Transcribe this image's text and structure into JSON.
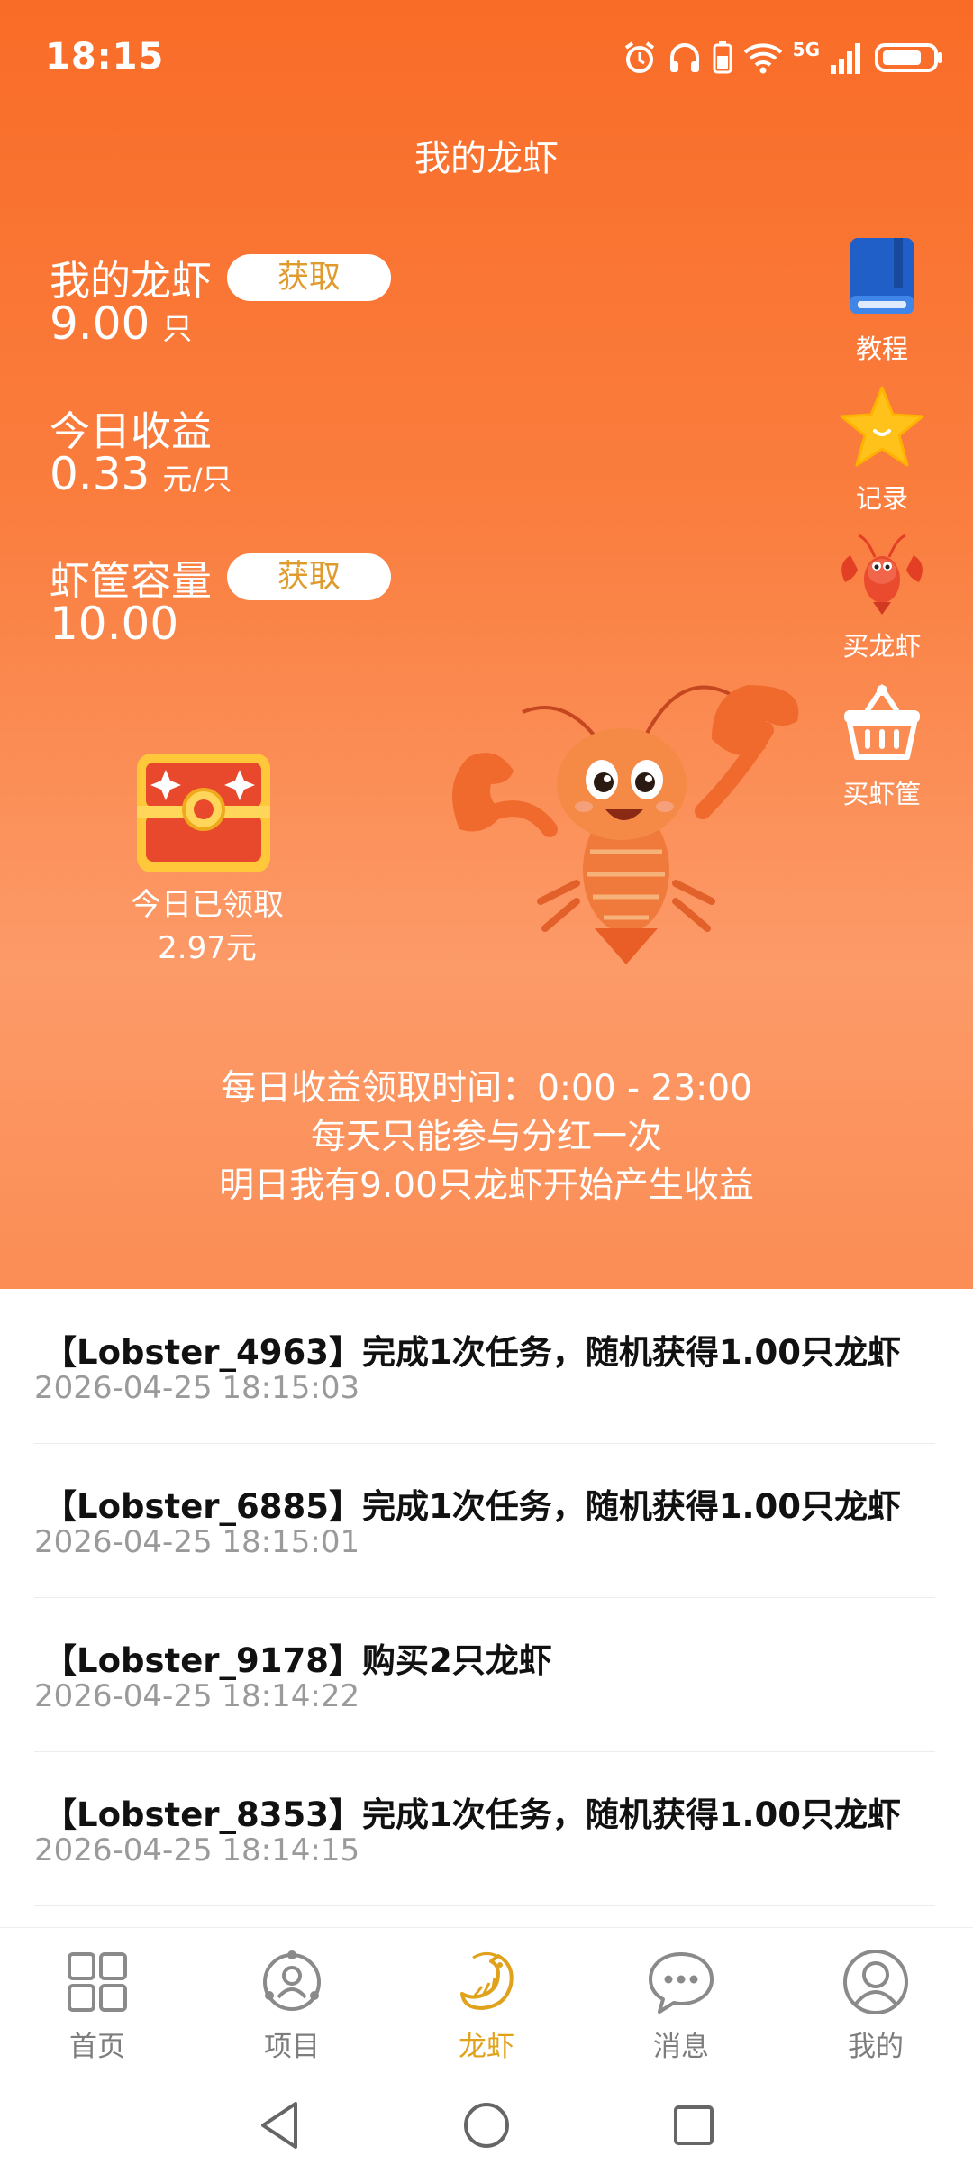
{
  "status_bar": {
    "time": "18:15",
    "network": "5G"
  },
  "header": {
    "title": "我的龙虾"
  },
  "stats": {
    "lobsters": {
      "label": "我的龙虾",
      "value": "9.00",
      "unit": "只",
      "button": "获取"
    },
    "today_income": {
      "label": "今日收益",
      "value": "0.33",
      "unit": "元/只"
    },
    "basket_capacity": {
      "label": "虾筐容量",
      "value": "10.00",
      "button": "获取"
    }
  },
  "side_actions": [
    {
      "label": "教程",
      "icon": "book-icon"
    },
    {
      "label": "记录",
      "icon": "star-icon"
    },
    {
      "label": "买龙虾",
      "icon": "lobster-icon"
    },
    {
      "label": "买虾筐",
      "icon": "basket-icon"
    }
  ],
  "claimed": {
    "label": "今日已领取",
    "amount": "2.97元"
  },
  "info": {
    "line1": "每日收益领取时间：0:00 - 23:00",
    "line2": "每天只能参与分红一次",
    "line3": "明日我有9.00只龙虾开始产生收益"
  },
  "feed": [
    {
      "title": "【Lobster_4963】完成1次任务，随机获得1.00只龙虾",
      "time": "2026-04-25 18:15:03"
    },
    {
      "title": "【Lobster_6885】完成1次任务，随机获得1.00只龙虾",
      "time": "2026-04-25 18:15:01"
    },
    {
      "title": "【Lobster_9178】购买2只龙虾",
      "time": "2026-04-25 18:14:22"
    },
    {
      "title": "【Lobster_8353】完成1次任务，随机获得1.00只龙虾",
      "time": "2026-04-25 18:14:15"
    }
  ],
  "bottom_nav": [
    {
      "label": "首页",
      "icon": "grid-icon",
      "active": false
    },
    {
      "label": "项目",
      "icon": "project-icon",
      "active": false
    },
    {
      "label": "龙虾",
      "icon": "shrimp-icon",
      "active": true
    },
    {
      "label": "消息",
      "icon": "chat-icon",
      "active": false
    },
    {
      "label": "我的",
      "icon": "profile-icon",
      "active": false
    }
  ],
  "colors": {
    "accent": "#f96c27",
    "active_nav": "#e0a21b",
    "button_text": "#e09b2e"
  }
}
